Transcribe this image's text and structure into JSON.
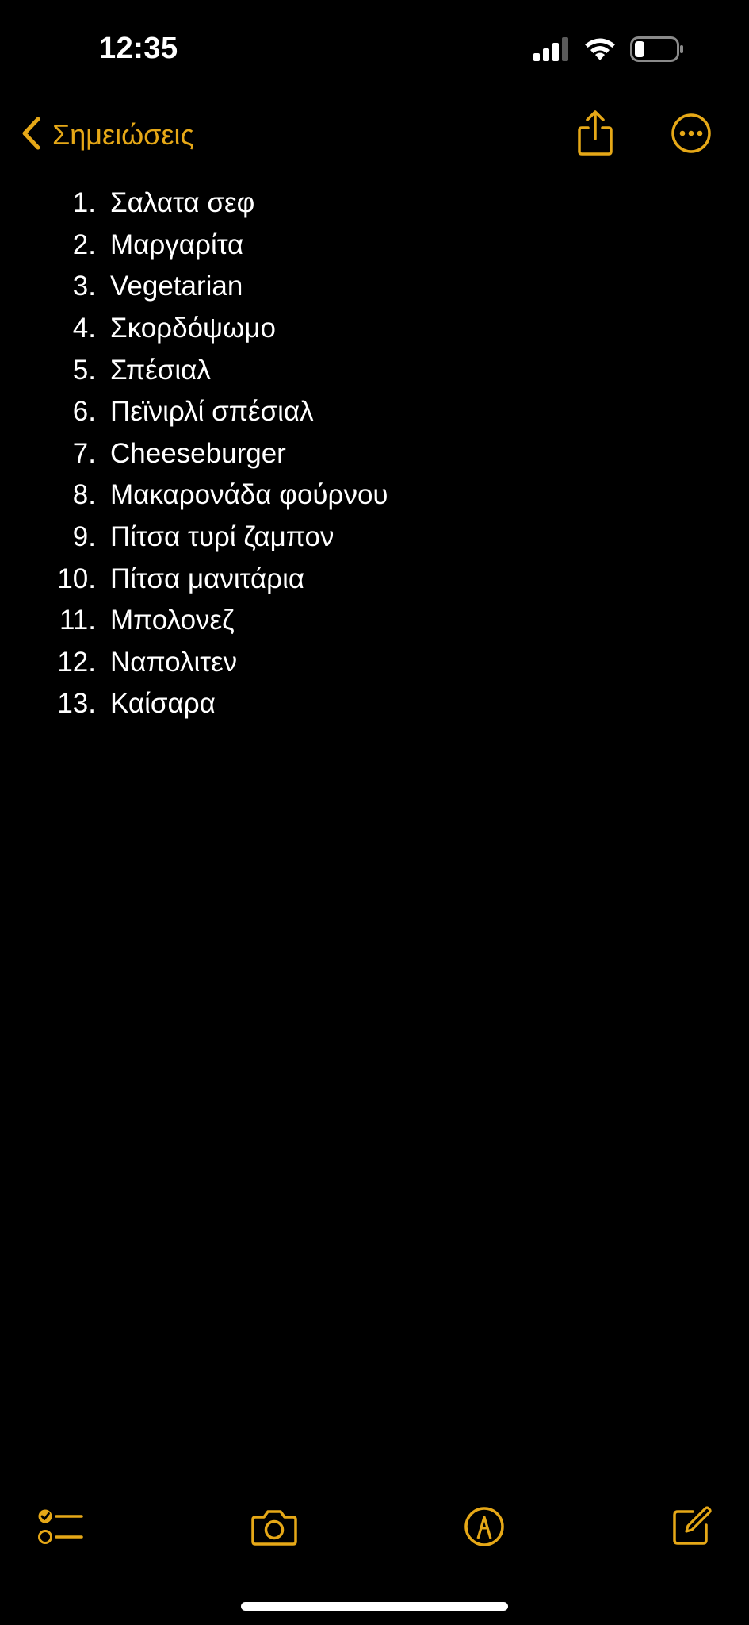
{
  "status_bar": {
    "time": "12:35",
    "icons": [
      "cellular-signal-icon",
      "wifi-icon",
      "battery-icon"
    ]
  },
  "nav": {
    "back_label": "Σημειώσεις",
    "icons": [
      "chevron-left-icon",
      "share-icon",
      "more-icon"
    ]
  },
  "note": {
    "items": [
      {
        "num": "1.",
        "text": "Σαλατα σεφ"
      },
      {
        "num": "2.",
        "text": "Μαργαρίτα"
      },
      {
        "num": "3.",
        "text": "Vegetarian"
      },
      {
        "num": "4.",
        "text": "Σκορδόψωμο"
      },
      {
        "num": "5.",
        "text": "Σπέσιαλ"
      },
      {
        "num": "6.",
        "text": "Πεϊνιρλί σπέσιαλ"
      },
      {
        "num": "7.",
        "text": "Cheeseburger"
      },
      {
        "num": "8.",
        "text": "Μακαρονάδα φούρνου"
      },
      {
        "num": "9.",
        "text": "Πίτσα τυρί ζαμπον"
      },
      {
        "num": "10.",
        "text": "Πίτσα μανιτάρια"
      },
      {
        "num": "11.",
        "text": "Μπολονεζ"
      },
      {
        "num": "12.",
        "text": "Ναπολιτεν"
      },
      {
        "num": "13.",
        "text": "Καίσαρα"
      }
    ]
  },
  "toolbar": {
    "icons": [
      "checklist-icon",
      "camera-icon",
      "markup-icon",
      "compose-icon"
    ]
  },
  "colors": {
    "background": "#000000",
    "accent": "#e6a817",
    "text": "#ffffff"
  }
}
